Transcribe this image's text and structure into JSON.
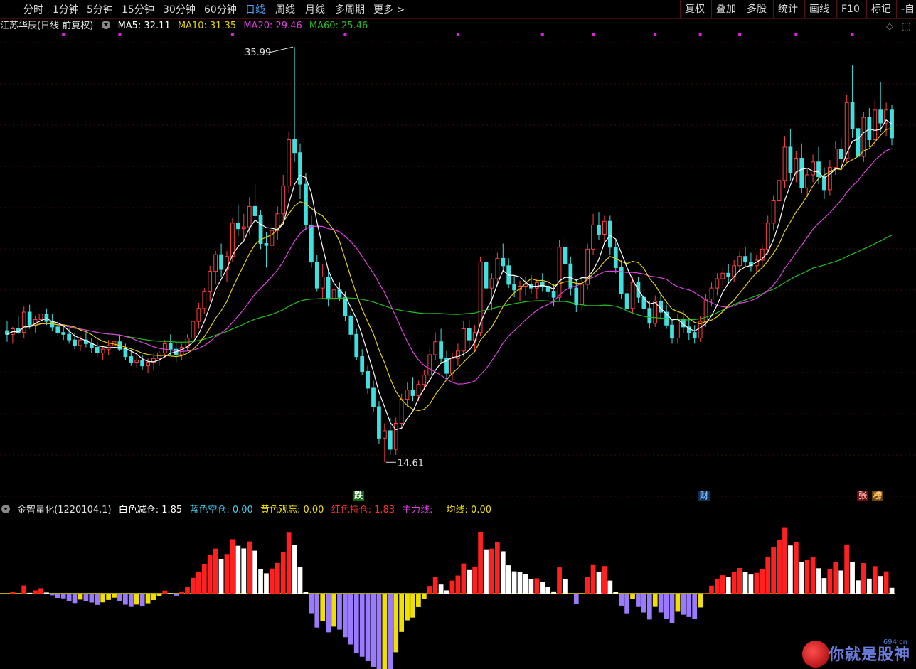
{
  "toolbar": {
    "periods": [
      "分时",
      "1分钟",
      "5分钟",
      "15分钟",
      "30分钟",
      "60分钟",
      "日线",
      "周线",
      "月线",
      "多周期",
      "更多 >"
    ],
    "active_period": "日线",
    "right_buttons": [
      "复权",
      "叠加",
      "多股",
      "统计",
      "画线",
      "F10",
      "标记",
      "-自"
    ]
  },
  "main_legend": {
    "title": "江苏华辰(日线 前复权)",
    "ma5": "MA5: 32.11",
    "ma10": "MA10: 31.35",
    "ma20": "MA20: 29.46",
    "ma60": "MA60: 25.46",
    "colors": {
      "ma5": "#ffffff",
      "ma10": "#e6d200",
      "ma20": "#e040e0",
      "ma60": "#20c020"
    }
  },
  "indicator_legend": {
    "name": "金智量化(1220104,1)",
    "white": "白色减仓: 1.85",
    "blue": "蓝色空仓: 0.00",
    "yellow": "黄色观忘: 0.00",
    "red": "红色持仓: 1.83",
    "main": "主力线: -",
    "avg": "均线: 0.00"
  },
  "marks": {
    "die": "跌",
    "cai": "财",
    "zhang": "张",
    "bang": "榜"
  },
  "annotations": {
    "high": "35.99",
    "low": "14.61"
  },
  "logo": {
    "text": "你就是股神",
    "sub": "694.cn"
  },
  "chart_data": {
    "type": "candlestick",
    "high_label": 35.99,
    "low_label": 14.61,
    "ylim": [
      13.0,
      38.0
    ],
    "colors": {
      "up": "#ff4040",
      "down": "#40e0e0",
      "bg": "#000000"
    },
    "candles": [
      [
        21.7,
        22.2,
        21.1,
        21.5
      ],
      [
        21.5,
        21.9,
        21.0,
        21.8
      ],
      [
        21.8,
        22.5,
        21.5,
        21.6
      ],
      [
        21.6,
        23.0,
        21.3,
        22.7
      ],
      [
        22.7,
        23.1,
        21.8,
        22.0
      ],
      [
        22.0,
        22.5,
        21.6,
        22.3
      ],
      [
        22.3,
        22.9,
        21.8,
        22.6
      ],
      [
        22.6,
        22.9,
        22.0,
        22.2
      ],
      [
        22.2,
        22.6,
        21.7,
        21.9
      ],
      [
        21.9,
        22.2,
        21.4,
        21.6
      ],
      [
        21.6,
        22.0,
        21.2,
        21.5
      ],
      [
        21.5,
        21.8,
        21.0,
        21.2
      ],
      [
        21.2,
        21.6,
        20.7,
        20.9
      ],
      [
        20.9,
        21.4,
        20.6,
        21.2
      ],
      [
        21.2,
        21.6,
        20.8,
        21.0
      ],
      [
        21.0,
        21.3,
        20.5,
        20.8
      ],
      [
        20.8,
        21.1,
        20.3,
        20.5
      ],
      [
        20.5,
        20.9,
        20.1,
        20.7
      ],
      [
        20.7,
        21.2,
        20.4,
        20.9
      ],
      [
        20.9,
        21.4,
        20.6,
        21.1
      ],
      [
        21.1,
        21.5,
        20.6,
        20.7
      ],
      [
        20.7,
        21.0,
        20.1,
        20.3
      ],
      [
        20.3,
        20.6,
        19.8,
        20.0
      ],
      [
        20.0,
        20.4,
        19.7,
        20.1
      ],
      [
        20.1,
        20.4,
        19.6,
        19.8
      ],
      [
        19.8,
        20.2,
        19.4,
        20.0
      ],
      [
        20.0,
        20.4,
        19.6,
        20.2
      ],
      [
        20.2,
        20.6,
        19.8,
        20.5
      ],
      [
        20.5,
        21.2,
        20.2,
        21.0
      ],
      [
        21.0,
        21.5,
        20.4,
        20.7
      ],
      [
        20.7,
        21.1,
        20.0,
        20.4
      ],
      [
        20.4,
        21.0,
        20.1,
        20.8
      ],
      [
        20.8,
        21.5,
        20.6,
        21.3
      ],
      [
        21.3,
        22.4,
        21.0,
        22.2
      ],
      [
        22.2,
        23.2,
        21.8,
        22.9
      ],
      [
        22.9,
        24.0,
        22.6,
        23.8
      ],
      [
        23.8,
        25.2,
        23.3,
        24.9
      ],
      [
        24.9,
        26.0,
        24.2,
        25.8
      ],
      [
        25.8,
        26.4,
        24.6,
        25.0
      ],
      [
        25.0,
        26.0,
        24.3,
        25.7
      ],
      [
        25.7,
        27.8,
        25.4,
        27.5
      ],
      [
        27.5,
        28.5,
        26.8,
        27.2
      ],
      [
        27.2,
        28.0,
        26.6,
        27.3
      ],
      [
        27.3,
        28.9,
        26.9,
        28.4
      ],
      [
        28.4,
        29.6,
        27.8,
        27.9
      ],
      [
        27.9,
        28.2,
        26.1,
        26.4
      ],
      [
        26.4,
        27.0,
        25.1,
        26.3
      ],
      [
        26.3,
        27.5,
        25.9,
        27.1
      ],
      [
        27.1,
        28.4,
        26.6,
        28.0
      ],
      [
        28.0,
        30.1,
        27.6,
        29.5
      ],
      [
        29.5,
        32.4,
        29.1,
        32.0
      ],
      [
        32.0,
        37.0,
        30.8,
        31.3
      ],
      [
        31.3,
        31.8,
        28.8,
        29.6
      ],
      [
        29.6,
        30.2,
        27.1,
        27.4
      ],
      [
        27.4,
        27.9,
        25.1,
        25.4
      ],
      [
        25.4,
        25.8,
        23.8,
        24.0
      ],
      [
        24.0,
        25.3,
        23.4,
        24.6
      ],
      [
        24.6,
        25.0,
        23.0,
        23.4
      ],
      [
        23.4,
        24.1,
        22.7,
        23.9
      ],
      [
        23.9,
        24.3,
        23.3,
        23.5
      ],
      [
        23.5,
        23.8,
        22.2,
        22.5
      ],
      [
        22.5,
        22.8,
        21.2,
        21.5
      ],
      [
        21.5,
        21.8,
        20.1,
        20.3
      ],
      [
        20.3,
        20.7,
        19.3,
        19.5
      ],
      [
        19.5,
        19.8,
        18.3,
        18.6
      ],
      [
        18.6,
        19.0,
        17.3,
        17.6
      ],
      [
        17.6,
        17.9,
        15.6,
        15.9
      ],
      [
        15.9,
        16.7,
        14.6,
        16.3
      ],
      [
        16.3,
        17.0,
        15.0,
        15.3
      ],
      [
        15.3,
        17.0,
        15.0,
        16.7
      ],
      [
        16.7,
        18.3,
        16.4,
        18.0
      ],
      [
        18.0,
        18.9,
        17.6,
        18.5
      ],
      [
        18.5,
        19.2,
        17.9,
        18.2
      ],
      [
        18.2,
        19.0,
        17.9,
        18.8
      ],
      [
        18.8,
        19.6,
        18.5,
        19.3
      ],
      [
        19.3,
        20.8,
        19.0,
        20.4
      ],
      [
        20.4,
        21.6,
        20.1,
        21.1
      ],
      [
        21.1,
        21.8,
        19.9,
        20.2
      ],
      [
        20.2,
        20.6,
        19.1,
        19.4
      ],
      [
        19.4,
        20.5,
        19.0,
        20.2
      ],
      [
        20.2,
        21.0,
        19.8,
        20.6
      ],
      [
        20.6,
        22.2,
        20.3,
        21.8
      ],
      [
        21.8,
        22.3,
        20.8,
        21.2
      ],
      [
        21.2,
        22.0,
        20.6,
        21.6
      ],
      [
        21.6,
        25.7,
        21.4,
        25.4
      ],
      [
        25.4,
        26.0,
        23.7,
        24.0
      ],
      [
        24.0,
        24.8,
        22.8,
        24.5
      ],
      [
        24.5,
        25.9,
        24.1,
        25.6
      ],
      [
        25.6,
        26.4,
        24.9,
        25.2
      ],
      [
        25.2,
        25.6,
        24.0,
        24.2
      ],
      [
        24.2,
        24.7,
        23.5,
        23.9
      ],
      [
        23.9,
        24.4,
        23.3,
        24.1
      ],
      [
        24.1,
        24.6,
        23.6,
        24.2
      ],
      [
        24.2,
        24.7,
        23.7,
        24.0
      ],
      [
        24.0,
        24.5,
        23.4,
        24.3
      ],
      [
        24.3,
        24.8,
        23.8,
        24.1
      ],
      [
        24.1,
        24.5,
        23.5,
        23.8
      ],
      [
        23.8,
        24.2,
        23.0,
        23.5
      ],
      [
        23.5,
        26.6,
        23.3,
        26.2
      ],
      [
        26.2,
        26.8,
        25.0,
        25.3
      ],
      [
        25.3,
        25.7,
        23.6,
        24.0
      ],
      [
        24.0,
        24.5,
        22.7,
        23.1
      ],
      [
        23.1,
        24.6,
        22.8,
        24.2
      ],
      [
        24.2,
        26.4,
        23.9,
        26.1
      ],
      [
        26.1,
        28.0,
        25.8,
        27.4
      ],
      [
        27.4,
        28.1,
        26.6,
        26.9
      ],
      [
        26.9,
        27.9,
        26.4,
        27.6
      ],
      [
        27.6,
        27.9,
        25.8,
        26.2
      ],
      [
        26.2,
        26.6,
        24.8,
        25.1
      ],
      [
        25.1,
        25.5,
        23.4,
        23.7
      ],
      [
        23.7,
        24.2,
        22.6,
        22.9
      ],
      [
        22.9,
        24.6,
        22.6,
        24.3
      ],
      [
        24.3,
        24.6,
        23.2,
        23.5
      ],
      [
        23.5,
        24.0,
        22.6,
        22.9
      ],
      [
        22.9,
        23.3,
        21.8,
        22.1
      ],
      [
        22.1,
        23.6,
        21.9,
        23.3
      ],
      [
        23.3,
        23.7,
        22.4,
        22.7
      ],
      [
        22.7,
        23.1,
        21.8,
        22.0
      ],
      [
        22.0,
        22.3,
        21.0,
        21.3
      ],
      [
        21.3,
        22.6,
        21.0,
        22.3
      ],
      [
        22.3,
        22.8,
        21.6,
        21.9
      ],
      [
        21.9,
        22.4,
        21.2,
        21.6
      ],
      [
        21.6,
        22.0,
        21.0,
        21.3
      ],
      [
        21.3,
        22.5,
        21.1,
        22.2
      ],
      [
        22.2,
        23.7,
        21.9,
        23.4
      ],
      [
        23.4,
        24.3,
        23.0,
        24.0
      ],
      [
        24.0,
        24.8,
        23.6,
        24.5
      ],
      [
        24.5,
        25.1,
        24.0,
        24.8
      ],
      [
        24.8,
        25.3,
        24.2,
        24.6
      ],
      [
        24.6,
        25.5,
        24.3,
        25.2
      ],
      [
        25.2,
        26.0,
        24.9,
        25.7
      ],
      [
        25.7,
        26.2,
        25.1,
        25.4
      ],
      [
        25.4,
        25.9,
        24.9,
        25.2
      ],
      [
        25.2,
        25.8,
        24.9,
        25.5
      ],
      [
        25.5,
        26.4,
        25.2,
        26.1
      ],
      [
        26.1,
        27.9,
        25.8,
        27.5
      ],
      [
        27.5,
        29.0,
        27.1,
        28.7
      ],
      [
        28.7,
        30.3,
        28.2,
        29.8
      ],
      [
        29.8,
        32.2,
        29.4,
        31.6
      ],
      [
        31.6,
        32.6,
        29.8,
        30.2
      ],
      [
        30.2,
        31.4,
        29.7,
        31.0
      ],
      [
        31.0,
        31.8,
        29.1,
        29.4
      ],
      [
        29.4,
        30.4,
        28.9,
        30.1
      ],
      [
        30.1,
        31.2,
        29.7,
        30.8
      ],
      [
        30.8,
        31.6,
        29.6,
        30.0
      ],
      [
        30.0,
        30.5,
        28.8,
        29.3
      ],
      [
        29.3,
        30.9,
        29.0,
        30.5
      ],
      [
        30.5,
        31.9,
        30.1,
        31.5
      ],
      [
        31.5,
        32.1,
        30.6,
        31.0
      ],
      [
        31.0,
        34.4,
        30.8,
        34.0
      ],
      [
        34.0,
        36.0,
        32.1,
        32.6
      ],
      [
        32.6,
        33.1,
        30.7,
        31.1
      ],
      [
        31.1,
        33.5,
        30.8,
        33.2
      ],
      [
        33.2,
        33.7,
        31.6,
        32.0
      ],
      [
        32.0,
        34.1,
        31.6,
        33.6
      ],
      [
        33.6,
        35.1,
        32.4,
        32.9
      ],
      [
        32.9,
        34.0,
        32.2,
        33.6
      ],
      [
        33.6,
        33.9,
        31.7,
        32.1
      ]
    ],
    "indicator_ylim": [
      -4.5,
      4.5
    ]
  }
}
